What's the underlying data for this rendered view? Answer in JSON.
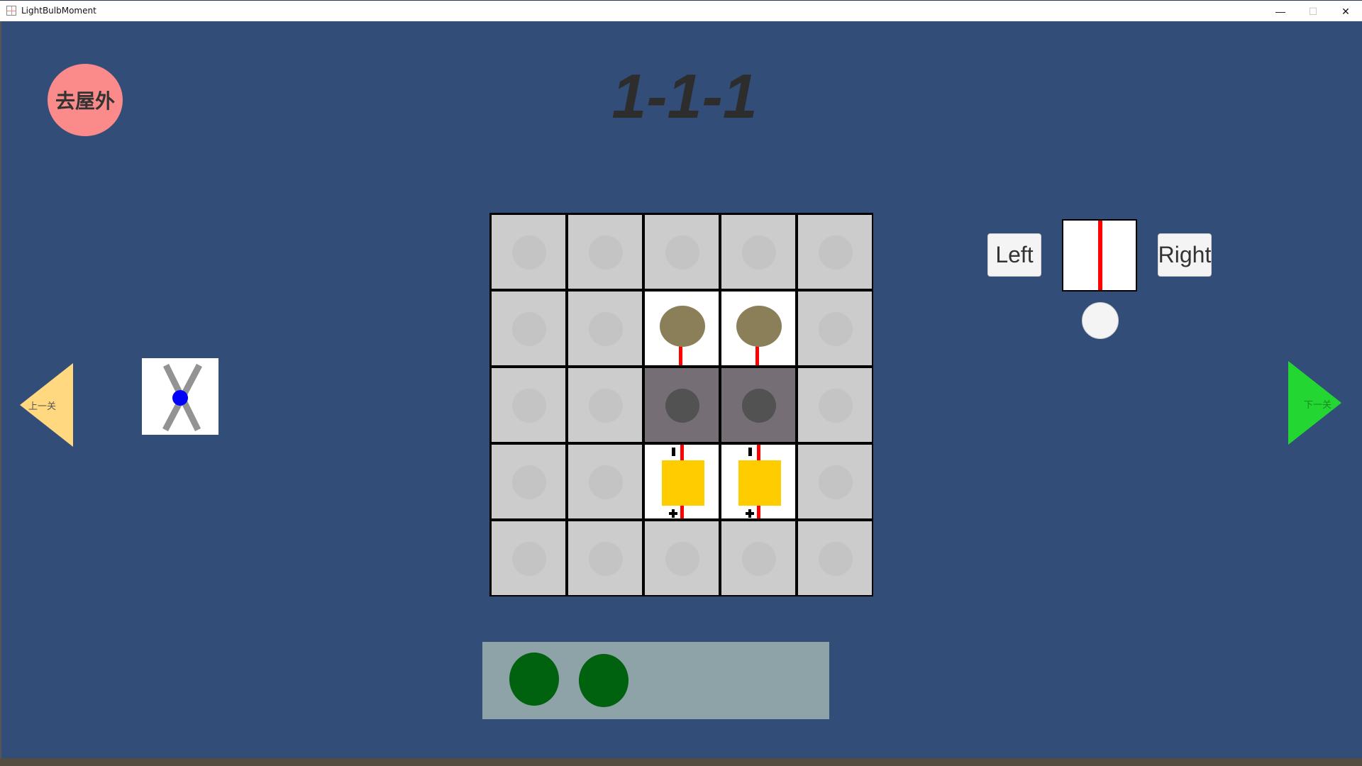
{
  "window": {
    "title": "LightBulbMoment",
    "minimize_icon": "minimize-icon",
    "maximize_icon": "maximize-icon",
    "close_icon": "close-icon",
    "minimize_glyph": "—",
    "maximize_glyph": "☐",
    "close_glyph": "✕"
  },
  "header": {
    "outdoor_button_label": "去屋外",
    "level_title": "1-1-1"
  },
  "navigation": {
    "prev_label": "上一关",
    "next_label": "下一关",
    "prev_color": "#ffd880",
    "next_color": "#24d632"
  },
  "side_tool": {
    "icon": "cross-wire-junction-icon",
    "junction_color": "#0000ff"
  },
  "rotation_panel": {
    "left_label": "Left",
    "right_label": "Right",
    "preview_piece": "straight-vertical-wire"
  },
  "board": {
    "rows": 5,
    "cols": 5,
    "cells": [
      [
        "empty",
        "empty",
        "empty",
        "empty",
        "empty"
      ],
      [
        "empty",
        "empty",
        "bulb",
        "bulb",
        "empty"
      ],
      [
        "empty",
        "empty",
        "blocked",
        "blocked",
        "empty"
      ],
      [
        "empty",
        "empty",
        "battery",
        "battery",
        "empty"
      ],
      [
        "empty",
        "empty",
        "empty",
        "empty",
        "empty"
      ]
    ],
    "colors": {
      "empty": "#cccccc",
      "bulb": "#8b7f5a",
      "blocked": "#756e74",
      "battery": "#ffcc00",
      "wire": "#ff0000"
    }
  },
  "inventory": {
    "items": [
      {
        "type": "green-piece"
      },
      {
        "type": "green-piece"
      }
    ],
    "item_color": "#00620f"
  }
}
